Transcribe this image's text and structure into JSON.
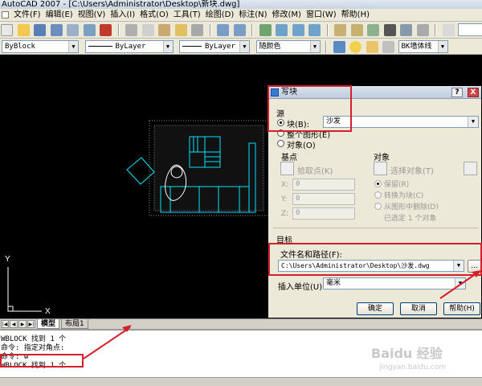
{
  "window": {
    "title": "AutoCAD 2007 - [C:\\Users\\Administrator\\Desktop\\新块.dwg]"
  },
  "menu": {
    "items": [
      "文件(F)",
      "编辑(E)",
      "视图(V)",
      "插入(I)",
      "格式(O)",
      "工具(T)",
      "绘图(D)",
      "标注(N)",
      "修改(M)",
      "窗口(W)",
      "帮助(H)"
    ]
  },
  "properties_bar": {
    "layer_value": "ByBlock",
    "linetype_value": "ByLayer",
    "lineweight_value": "ByLayer",
    "color_value": "随颜色",
    "layer_right_value": "BK墙体线"
  },
  "layout_tabs": {
    "model": "模型",
    "layout1": "布局1"
  },
  "ucs": {
    "x_label": "X",
    "y_label": "Y"
  },
  "command_lines": [
    "WBLOCK 找到 1 个",
    "命令: 指定对角点:",
    "命令: w",
    "WBLOCK 找到 1 个"
  ],
  "dialog": {
    "title": "写块",
    "help_button": "?",
    "close_button": "X",
    "source_label": "源",
    "radio_block": "块(B):",
    "block_value": "沙发",
    "radio_whole": "整个图形(E)",
    "radio_objects": "对象(O)",
    "basepoint_label": "基点",
    "pick_point": "拾取点(K)",
    "x_label": "X:",
    "y_label": "Y:",
    "z_label": "Z:",
    "x_value": "0",
    "y_value": "0",
    "z_value": "0",
    "objects_label": "对象",
    "select_objects": "选择对象(T)",
    "retain": "保留(R)",
    "convert": "转换为块(C)",
    "delete": "从图形中删除(D)",
    "selected_info": "已选定 1 个对象",
    "target_label": "目标",
    "path_label": "文件名和路径(F):",
    "path_value": "C:\\Users\\Administrator\\Desktop\\沙发.dwg",
    "browse_button": "...",
    "units_label": "插入单位(U):",
    "units_value": "毫米",
    "ok_button": "确定",
    "cancel_button": "取消",
    "help_text_button": "帮助(H)"
  },
  "watermark": {
    "line1": "Baidu 经验",
    "line2": "jingyan.baidu.com"
  },
  "colors": {
    "annotation": "#d4202a",
    "drawing_bg": "#000000",
    "furniture_line": "#00e5ff"
  }
}
